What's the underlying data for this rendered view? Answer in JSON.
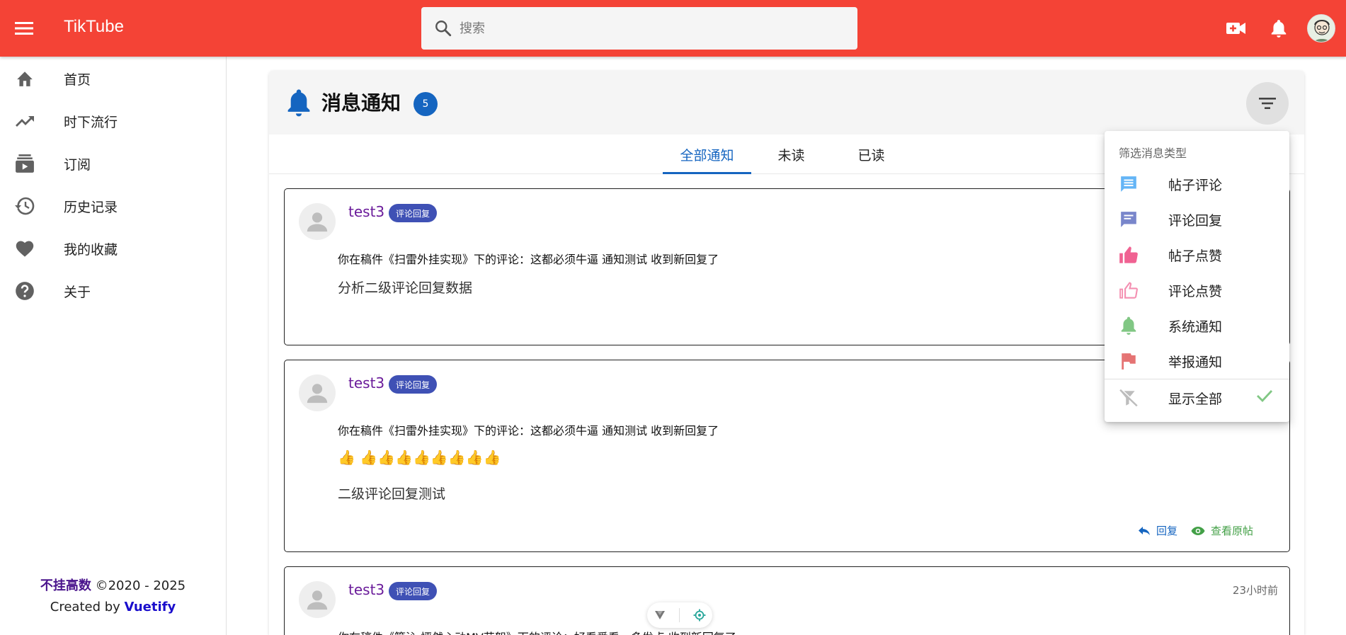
{
  "app": {
    "title": "TikTube"
  },
  "search": {
    "placeholder": "搜索"
  },
  "sidebar": {
    "items": [
      {
        "label": "首页",
        "icon": "home-icon"
      },
      {
        "label": "时下流行",
        "icon": "trending-up-icon"
      },
      {
        "label": "订阅",
        "icon": "subscriptions-icon"
      },
      {
        "label": "历史记录",
        "icon": "history-icon"
      },
      {
        "label": "我的收藏",
        "icon": "heart-icon"
      },
      {
        "label": "关于",
        "icon": "help-circle-icon"
      }
    ],
    "footer": {
      "brand": "不挂高数",
      "copyright": " ©2020 - 2025",
      "created_by": "Created by ",
      "framework": "Vuetify"
    }
  },
  "notifications": {
    "title": "消息通知",
    "unread_count": "5",
    "tabs": [
      "全部通知",
      "未读",
      "已读"
    ],
    "items": [
      {
        "user": "test3",
        "tag": "评论回复",
        "time": "",
        "context": "你在稿件《扫雷外挂实现》下的评论：这都必须牛逼 通知测试 收到新回复了",
        "message": "分析二级评论回复数据"
      },
      {
        "user": "test3",
        "tag": "评论回复",
        "time": "",
        "context": "你在稿件《扫雷外挂实现》下的评论：这都必须牛逼 通知测试 收到新回复了",
        "emoji": "👍 👍👍👍👍👍👍👍👍",
        "message": "二级评论回复测试",
        "actions": {
          "reply": "回复",
          "view": "查看原帖"
        }
      },
      {
        "user": "test3",
        "tag": "评论回复",
        "time": "23小时前",
        "context": "你在稿件《簡沁 怦然心动MV花絮》下的评论：好看爱看，多发点 收到新回复了"
      }
    ]
  },
  "filter_menu": {
    "header": "筛选消息类型",
    "items": [
      {
        "label": "帖子评论",
        "icon": "comment-icon",
        "color": "#64b5f6"
      },
      {
        "label": "评论回复",
        "icon": "comment-text-icon",
        "color": "#7986cb"
      },
      {
        "label": "帖子点赞",
        "icon": "thumb-up-icon",
        "color": "#f06292"
      },
      {
        "label": "评论点赞",
        "icon": "thumb-up-outline-icon",
        "color": "#f48fb1"
      },
      {
        "label": "系统通知",
        "icon": "bell-icon",
        "color": "#81c784"
      },
      {
        "label": "举报通知",
        "icon": "flag-icon",
        "color": "#e57373"
      },
      {
        "label": "显示全部",
        "icon": "filter-remove-icon",
        "color": "#bdbdbd",
        "selected": true
      }
    ]
  },
  "colors": {
    "appbar": "#f44336",
    "accent": "#1565c0",
    "tag": "#3f51b5",
    "username": "#6a1b9a"
  }
}
